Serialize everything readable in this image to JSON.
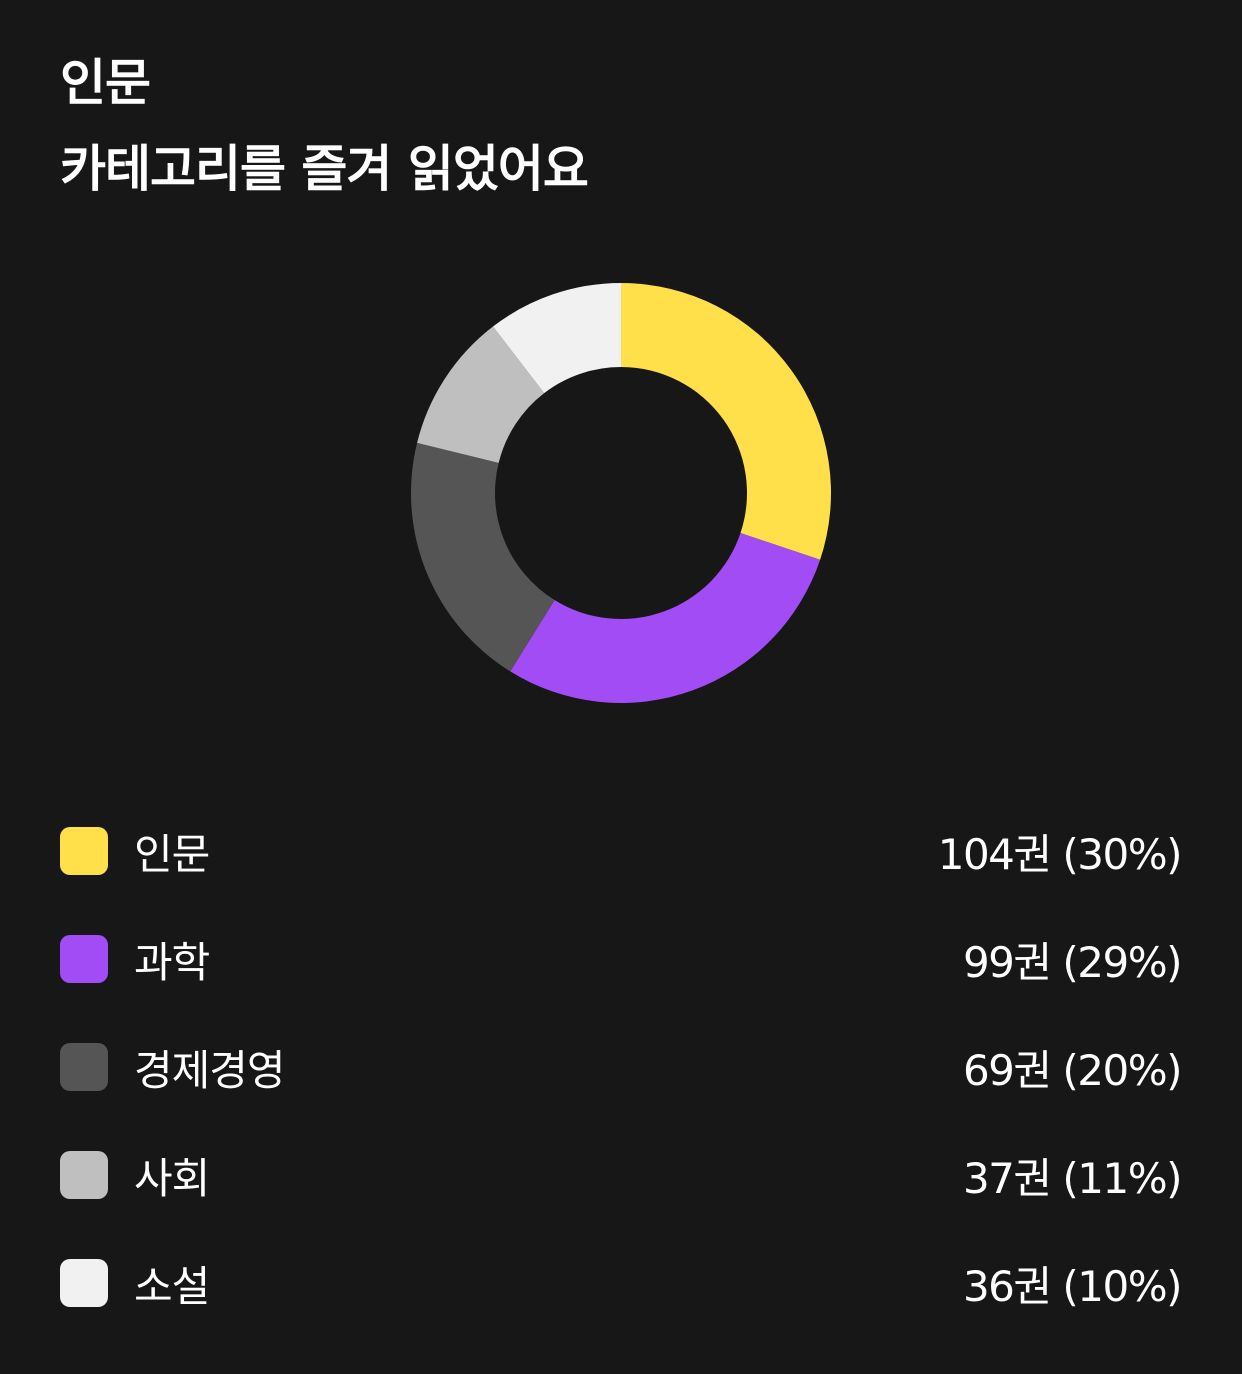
{
  "header": {
    "line1": "인문",
    "line2": "카테고리를 즐겨 읽었어요"
  },
  "chart_data": {
    "type": "pie",
    "donut": true,
    "unit": "권",
    "series": [
      {
        "name": "인문",
        "value": 104,
        "percent": "30%",
        "value_label": "104권 (30%)",
        "color": "#FFDF4A"
      },
      {
        "name": "과학",
        "value": 99,
        "percent": "29%",
        "value_label": "99권 (29%)",
        "color": "#A24CF6"
      },
      {
        "name": "경제경영",
        "value": 69,
        "percent": "20%",
        "value_label": "69권 (20%)",
        "color": "#555555"
      },
      {
        "name": "사회",
        "value": 37,
        "percent": "11%",
        "value_label": "37권 (11%)",
        "color": "#BFBFBF"
      },
      {
        "name": "소설",
        "value": 36,
        "percent": "10%",
        "value_label": "36권 (10%)",
        "color": "#F1F1F1"
      }
    ]
  },
  "theme": {
    "background": "#171717",
    "text": "#FFFFFF"
  }
}
